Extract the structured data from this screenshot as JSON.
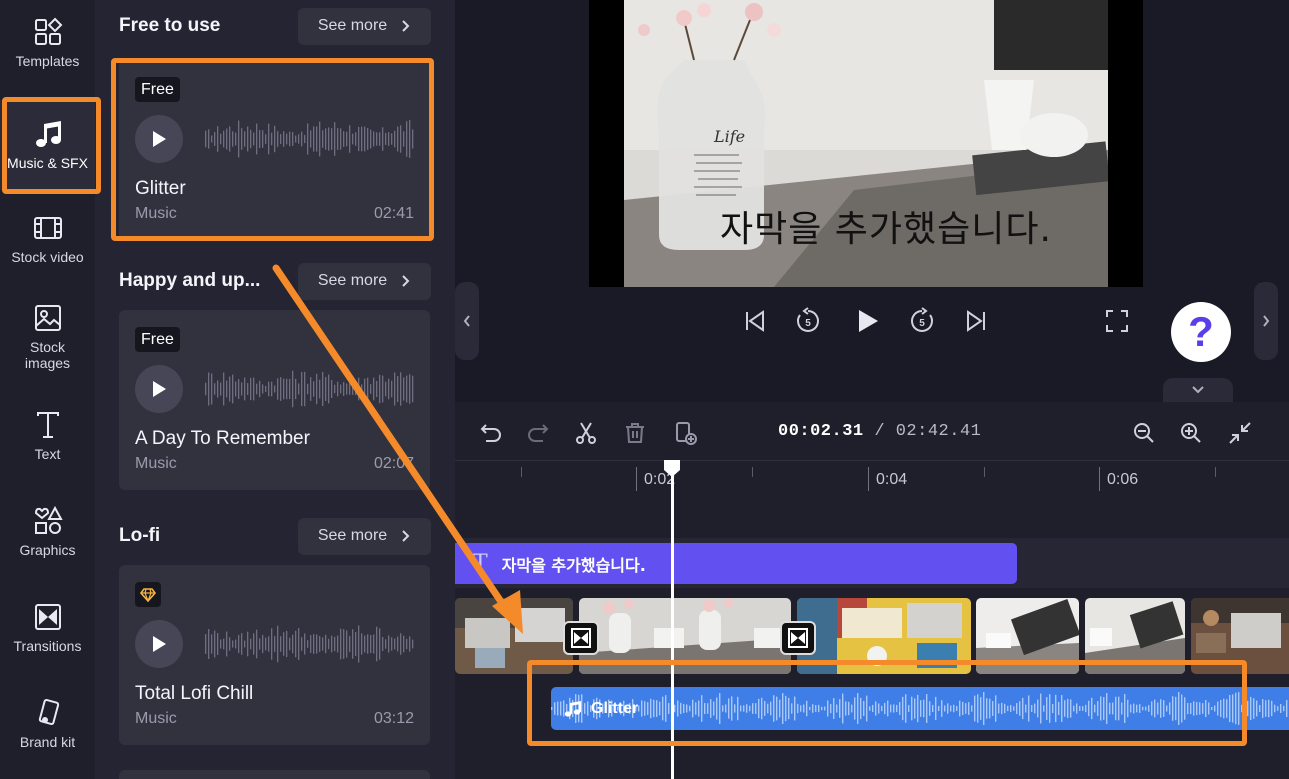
{
  "rail": {
    "items": [
      {
        "label": "Templates",
        "icon": "templates-icon"
      },
      {
        "label": "Music & SFX",
        "icon": "music-note-icon",
        "active": true
      },
      {
        "label": "Stock video",
        "icon": "film-icon"
      },
      {
        "label": "Stock\nimages",
        "icon": "image-icon"
      },
      {
        "label": "Text",
        "icon": "text-t-icon"
      },
      {
        "label": "Graphics",
        "icon": "shapes-icon"
      },
      {
        "label": "Transitions",
        "icon": "transition-icon"
      },
      {
        "label": "Brand kit",
        "icon": "brand-kit-icon"
      }
    ]
  },
  "library": {
    "see_more": "See more",
    "sections": [
      {
        "title": "Free to use",
        "card": {
          "badge": "Free",
          "title": "Glitter",
          "category": "Music",
          "duration": "02:41"
        }
      },
      {
        "title": "Happy and up...",
        "card": {
          "badge": "Free",
          "title": "A Day To Remember",
          "category": "Music",
          "duration": "02:07"
        }
      },
      {
        "title": "Lo-fi",
        "card": {
          "badge": "premium-gem-icon",
          "title": "Total Lofi Chill",
          "category": "Music",
          "duration": "03:12"
        }
      }
    ]
  },
  "preview": {
    "caption": "자막을 추가했습니다.",
    "bottle_label": "Life"
  },
  "help": {
    "label": "?"
  },
  "timeline": {
    "current_time": "00:02.31",
    "separator": " / ",
    "total_time": "02:42.41",
    "ruler": [
      "0:02",
      "0:04",
      "0:06"
    ],
    "text_clip": {
      "icon": "T",
      "label": "자막을 추가했습니다."
    },
    "audio_clip": {
      "label": "Glitter"
    }
  },
  "colors": {
    "accent_highlight": "#f58a2b",
    "text_clip": "#6350f0",
    "audio_clip": "#3f7ee6",
    "help_icon": "#5b3ee8"
  }
}
